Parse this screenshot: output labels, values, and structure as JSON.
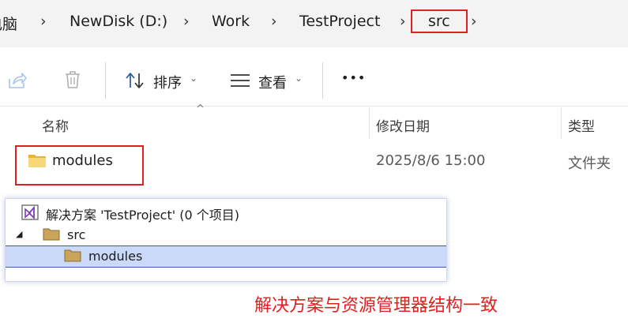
{
  "breadcrumb": {
    "items": [
      "电脑",
      "NewDisk (D:)",
      "Work",
      "TestProject",
      "src"
    ]
  },
  "toolbar": {
    "sort_label": "排序",
    "view_label": "查看",
    "more_label": "•••"
  },
  "columns": {
    "name": "名称",
    "modified": "修改日期",
    "type": "类型"
  },
  "files": [
    {
      "name": "modules",
      "modified": "2025/8/6 15:00",
      "type": "文件夹"
    }
  ],
  "solution": {
    "title": "解决方案 'TestProject' (0 个项目)",
    "nodes": [
      "src",
      "modules"
    ]
  },
  "annotation": "解决方案与资源管理器结构一致",
  "colors": {
    "accent_red": "#e02020",
    "folder_yellow": "#f2c94c",
    "vs_purple": "#7b3fb5",
    "selection_blue": "#c9d9f7"
  }
}
